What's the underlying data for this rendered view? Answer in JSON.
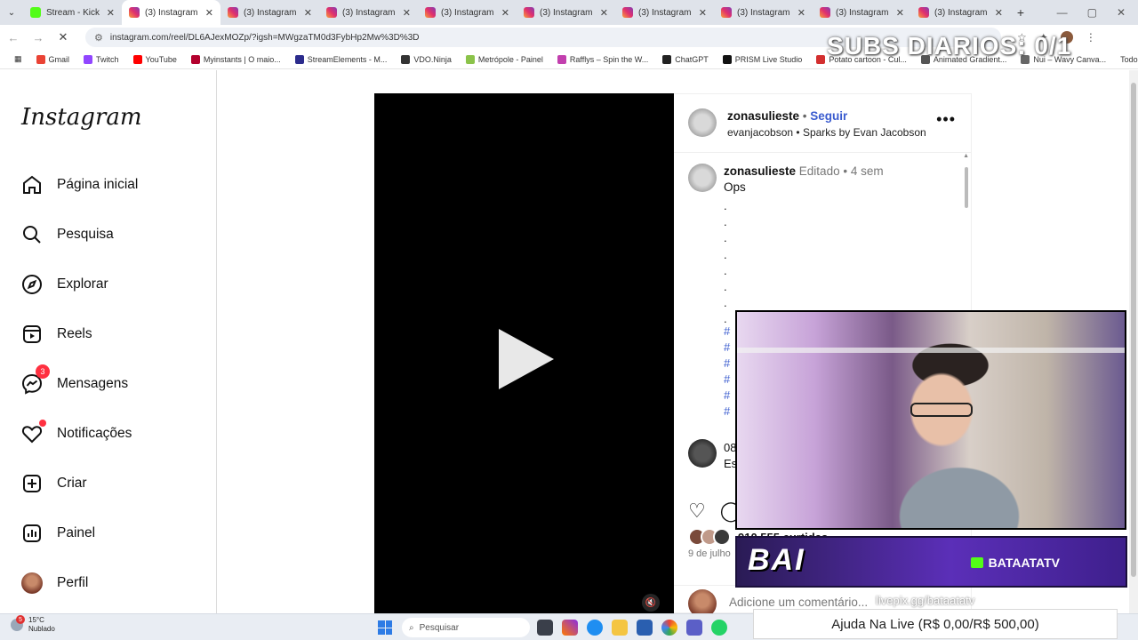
{
  "browser": {
    "tabs": [
      {
        "label": "Stream - Kick Da",
        "fav": "kick"
      },
      {
        "label": "(3) Instagram",
        "fav": "ig",
        "active": true
      },
      {
        "label": "(3) Instagram",
        "fav": "ig"
      },
      {
        "label": "(3) Instagram",
        "fav": "ig"
      },
      {
        "label": "(3) Instagram",
        "fav": "ig"
      },
      {
        "label": "(3) Instagram",
        "fav": "ig"
      },
      {
        "label": "(3) Instagram",
        "fav": "ig"
      },
      {
        "label": "(3) Instagram",
        "fav": "ig"
      },
      {
        "label": "(3) Instagram",
        "fav": "ig"
      },
      {
        "label": "(3) Instagram",
        "fav": "ig"
      }
    ],
    "url": "instagram.com/reel/DL6AJexMOZp/?igsh=MWgzaTM0d3FybHp2Mw%3D%3D",
    "bookmarks": [
      {
        "label": "Gmail",
        "color": "#ea4335"
      },
      {
        "label": "Twitch",
        "color": "#9146ff"
      },
      {
        "label": "YouTube",
        "color": "#ff0000"
      },
      {
        "label": "Myinstants | O maio...",
        "color": "#b3002d"
      },
      {
        "label": "StreamElements - M...",
        "color": "#2b2b8c"
      },
      {
        "label": "VDO.Ninja",
        "color": "#333333"
      },
      {
        "label": "Metrópole - Painel",
        "color": "#8bc34a"
      },
      {
        "label": "Rafflys – Spin the W...",
        "color": "#c23fae"
      },
      {
        "label": "ChatGPT",
        "color": "#222222"
      },
      {
        "label": "PRISM Live Studio",
        "color": "#111111"
      },
      {
        "label": "Potato cartoon - Cul...",
        "color": "#d32f2f"
      },
      {
        "label": "Animated Gradient...",
        "color": "#555555"
      },
      {
        "label": "Nui – Wavy Canva...",
        "color": "#666666"
      }
    ],
    "all_bookmarks": "Todos os favoritos"
  },
  "overlay": {
    "subs": "SUBS DIARIOS: 0/1",
    "banner_title": "BAI",
    "channel": "BATAATATV",
    "pix": "livepix.gg/bataatatv",
    "donate": "Ajuda Na Live (R$ 0,00/R$ 500,00)"
  },
  "sidebar": {
    "logo": "Instagram",
    "items": [
      {
        "label": "Página inicial"
      },
      {
        "label": "Pesquisa"
      },
      {
        "label": "Explorar"
      },
      {
        "label": "Reels"
      },
      {
        "label": "Mensagens",
        "badge": "3"
      },
      {
        "label": "Notificações"
      },
      {
        "label": "Criar"
      },
      {
        "label": "Painel"
      },
      {
        "label": "Perfil"
      }
    ]
  },
  "post": {
    "username": "zonasulieste",
    "separator": "•",
    "follow": "Seguir",
    "audio_artist": "evanjacobson",
    "audio_title": "Sparks by Evan Jacobson",
    "edited": "Editado",
    "age": "4 sem",
    "caption": "Ops",
    "comment_user": "08",
    "comment_text": "Es",
    "likes": "910.555 curtidas",
    "date": "9 de julho",
    "comment_placeholder": "Adicione um comentário..."
  },
  "taskbar": {
    "temp": "15°C",
    "weather": "Nublado",
    "weather_badge": "5",
    "search_placeholder": "Pesquisar"
  }
}
